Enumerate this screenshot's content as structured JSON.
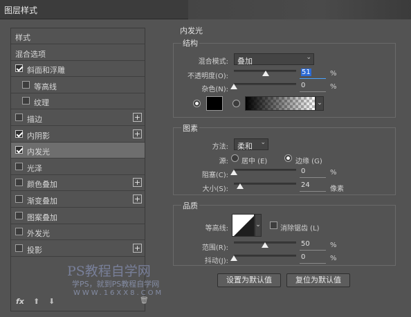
{
  "window": {
    "title": "图层样式"
  },
  "left_panel": {
    "items": [
      {
        "label": "样式",
        "checkbox": false,
        "plus": false,
        "indent": 0
      },
      {
        "label": "混合选项",
        "checkbox": false,
        "plus": false,
        "indent": 0
      },
      {
        "label": "斜面和浮雕",
        "checkbox": true,
        "checked": true,
        "plus": false,
        "indent": 0
      },
      {
        "label": "等高线",
        "checkbox": true,
        "checked": false,
        "plus": false,
        "indent": 1
      },
      {
        "label": "纹理",
        "checkbox": true,
        "checked": false,
        "plus": false,
        "indent": 1
      },
      {
        "label": "描边",
        "checkbox": true,
        "checked": false,
        "plus": true,
        "indent": 0
      },
      {
        "label": "内阴影",
        "checkbox": true,
        "checked": true,
        "plus": true,
        "indent": 0
      },
      {
        "label": "内发光",
        "checkbox": true,
        "checked": true,
        "plus": false,
        "indent": 0,
        "selected": true
      },
      {
        "label": "光泽",
        "checkbox": true,
        "checked": false,
        "plus": false,
        "indent": 0
      },
      {
        "label": "颜色叠加",
        "checkbox": true,
        "checked": false,
        "plus": true,
        "indent": 0
      },
      {
        "label": "渐变叠加",
        "checkbox": true,
        "checked": false,
        "plus": true,
        "indent": 0
      },
      {
        "label": "图案叠加",
        "checkbox": true,
        "checked": false,
        "plus": false,
        "indent": 0
      },
      {
        "label": "外发光",
        "checkbox": true,
        "checked": false,
        "plus": false,
        "indent": 0
      },
      {
        "label": "投影",
        "checkbox": true,
        "checked": false,
        "plus": true,
        "indent": 0
      }
    ],
    "bottom": {
      "fx": "fx",
      "up": "⬆",
      "down": "⬇",
      "trash": "🗑"
    }
  },
  "inner_glow": {
    "heading": "内发光",
    "structure": {
      "title": "结构",
      "blend_mode_label": "混合模式:",
      "blend_mode_value": "叠加",
      "opacity_label": "不透明度(O):",
      "opacity_value": "51",
      "opacity_fraction": 0.51,
      "noise_label": "杂色(N):",
      "noise_value": "0",
      "noise_fraction": 0,
      "unit": "%"
    },
    "elements": {
      "title": "图素",
      "method_label": "方法:",
      "method_value": "柔和",
      "source_label": "源:",
      "source_center": "居中 (E)",
      "source_edge": "边缘 (G)",
      "choke_label": "阻塞(C):",
      "choke_value": "0",
      "choke_fraction": 0,
      "size_label": "大小(S):",
      "size_value": "24",
      "size_fraction": 0.1,
      "size_unit": "像素",
      "unit": "%"
    },
    "quality": {
      "title": "品质",
      "contour_label": "等高线:",
      "antialias_label": "消除锯齿 (L)",
      "range_label": "范围(R):",
      "range_value": "50",
      "range_fraction": 0.5,
      "jitter_label": "抖动(J):",
      "jitter_value": "0",
      "jitter_fraction": 0,
      "unit": "%"
    },
    "buttons": {
      "set_default": "设置为默认值",
      "reset_default": "复位为默认值"
    }
  },
  "watermark": {
    "line1": "PS教程自学网",
    "line2": "学PS，就到PS教程自学网",
    "line3": "WWW.16XX8.COM"
  }
}
